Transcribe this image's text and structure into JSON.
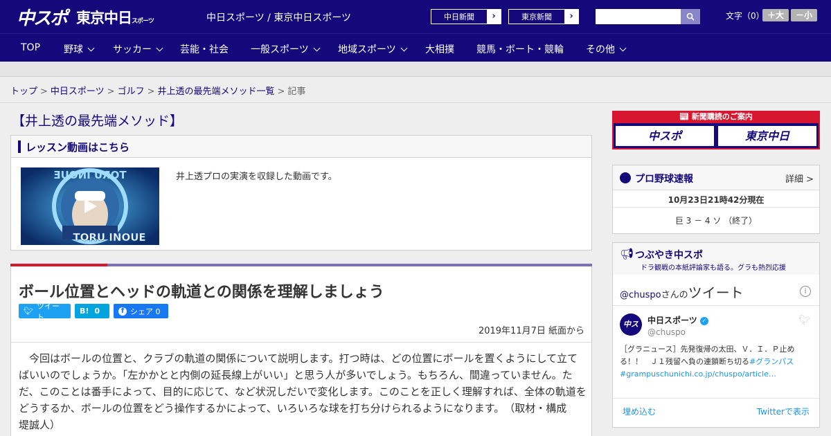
{
  "header": {
    "logo_chuspo": "中スポ",
    "logo_tokyo": "東京中日",
    "logo_tokyo_sub": "スポーツ",
    "siteline": "中日スポーツ / 東京中日スポーツ",
    "btn_chunichi": "中日新聞",
    "btn_tokyo": "東京新聞",
    "search_placeholder": "",
    "font_label": "文字（0）",
    "font_large": "＋大",
    "font_small": "－小"
  },
  "nav": {
    "items": [
      "TOP",
      "野球",
      "サッカー",
      "芸能・社会",
      "一般スポーツ",
      "地域スポーツ",
      "大相撲",
      "競馬・ボート・競輪",
      "その他"
    ]
  },
  "breadcrumb": {
    "items": [
      "トップ",
      "中日スポーツ",
      "ゴルフ",
      "井上透の最先端メソッド一覧"
    ],
    "sep": ">",
    "current": "記事"
  },
  "section_title": "【井上透の最先端メソッド】",
  "video": {
    "heading": "レッスン動画はこちら",
    "thumb_text": "TORU INOUE",
    "description": "井上透プロの実演を収録した動画です。"
  },
  "article": {
    "title": "ボール位置とヘッドの軌道との関係を理解しましょう",
    "tweet_label": "ツイート",
    "hatena_label": "B!",
    "hatena_count": "0",
    "fb_label": "シェア 0",
    "date": "2019年11月7日 紙面から",
    "body": "今回はボールの位置と、クラブの軌道の関係について説明します。打つ時は、どの位置にボールを置くようにして立てばいいのでしょうか。「左かかとと内側の延長線上がいい」と思う人が多いでしょう。もちろん、間違っていません。ただ、このことは番手によって、目的に応じて、など状況しだいで変化します。このことを正しく理解すれば、全体の軌道をどうするか、ボールの位置をどう操作するかによって、いろいろな球を打ち分けられるようになります。　（取材・構成　堤誠人）"
  },
  "promo": {
    "top": "新聞購読のご案内",
    "btn1": "中スポ",
    "btn2": "東京中日"
  },
  "baseball": {
    "title": "プロ野球速報",
    "more": "詳細 >",
    "time": "10月23日21時42分現在",
    "score": "巨 3 － 4 ソ （終了）"
  },
  "tweets": {
    "title": "つぶやき中スポ",
    "subtitle": "ドラ観戦の本紙評論家も語る。グラも熱烈応援",
    "handle": "@chuspo",
    "san": "さんの",
    "big": "ツイート",
    "avatar": "中スポ",
    "name": "中日スポーツ",
    "handle2": "@chuspo",
    "text": "［グラニュース］先発復帰の太田、Ｖ．Ｉ．Ｐ止める！！　Ｊ１残留へ負の連鎖断ち切る",
    "tag": "#グランパス",
    "link": "#grampuschunichi.co.jp/chuspo/article…",
    "embed": "埋め込む",
    "view": "Twitterで表示"
  }
}
